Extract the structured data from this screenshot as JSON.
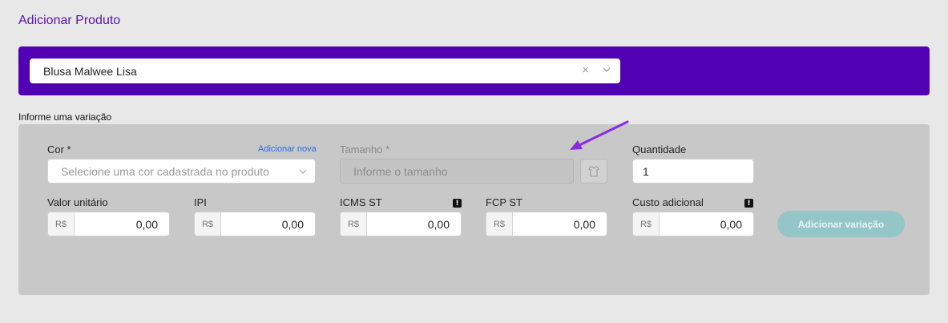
{
  "page": {
    "title": "Adicionar Produto"
  },
  "product": {
    "selected": "Blusa Malwee Lisa",
    "clear_icon": "×"
  },
  "variation": {
    "section_label": "Informe uma variação",
    "cor": {
      "label": "Cor *",
      "add_link": "Adicionar nova",
      "placeholder": "Selecione uma cor cadastrada no produto"
    },
    "tamanho": {
      "label": "Tamanho *",
      "placeholder": "Informe o tamanho"
    },
    "quantidade": {
      "label": "Quantidade",
      "value": "1"
    },
    "valor_unitario": {
      "label": "Valor unitário",
      "prefix": "R$",
      "value": "0,00"
    },
    "ipi": {
      "label": "IPI",
      "prefix": "R$",
      "value": "0,00"
    },
    "icms_st": {
      "label": "ICMS ST",
      "prefix": "R$",
      "value": "0,00",
      "info_icon": "!"
    },
    "fcp_st": {
      "label": "FCP ST",
      "prefix": "R$",
      "value": "0,00"
    },
    "custo_adicional": {
      "label": "Custo adicional",
      "prefix": "R$",
      "value": "0,00",
      "info_icon": "!"
    },
    "add_button": "Adicionar variação"
  },
  "colors": {
    "brand": "#5200b3",
    "title": "#5a12b8",
    "button": "#95c6c7",
    "link": "#2a6ee8",
    "annotation_arrow": "#8a2be2"
  }
}
